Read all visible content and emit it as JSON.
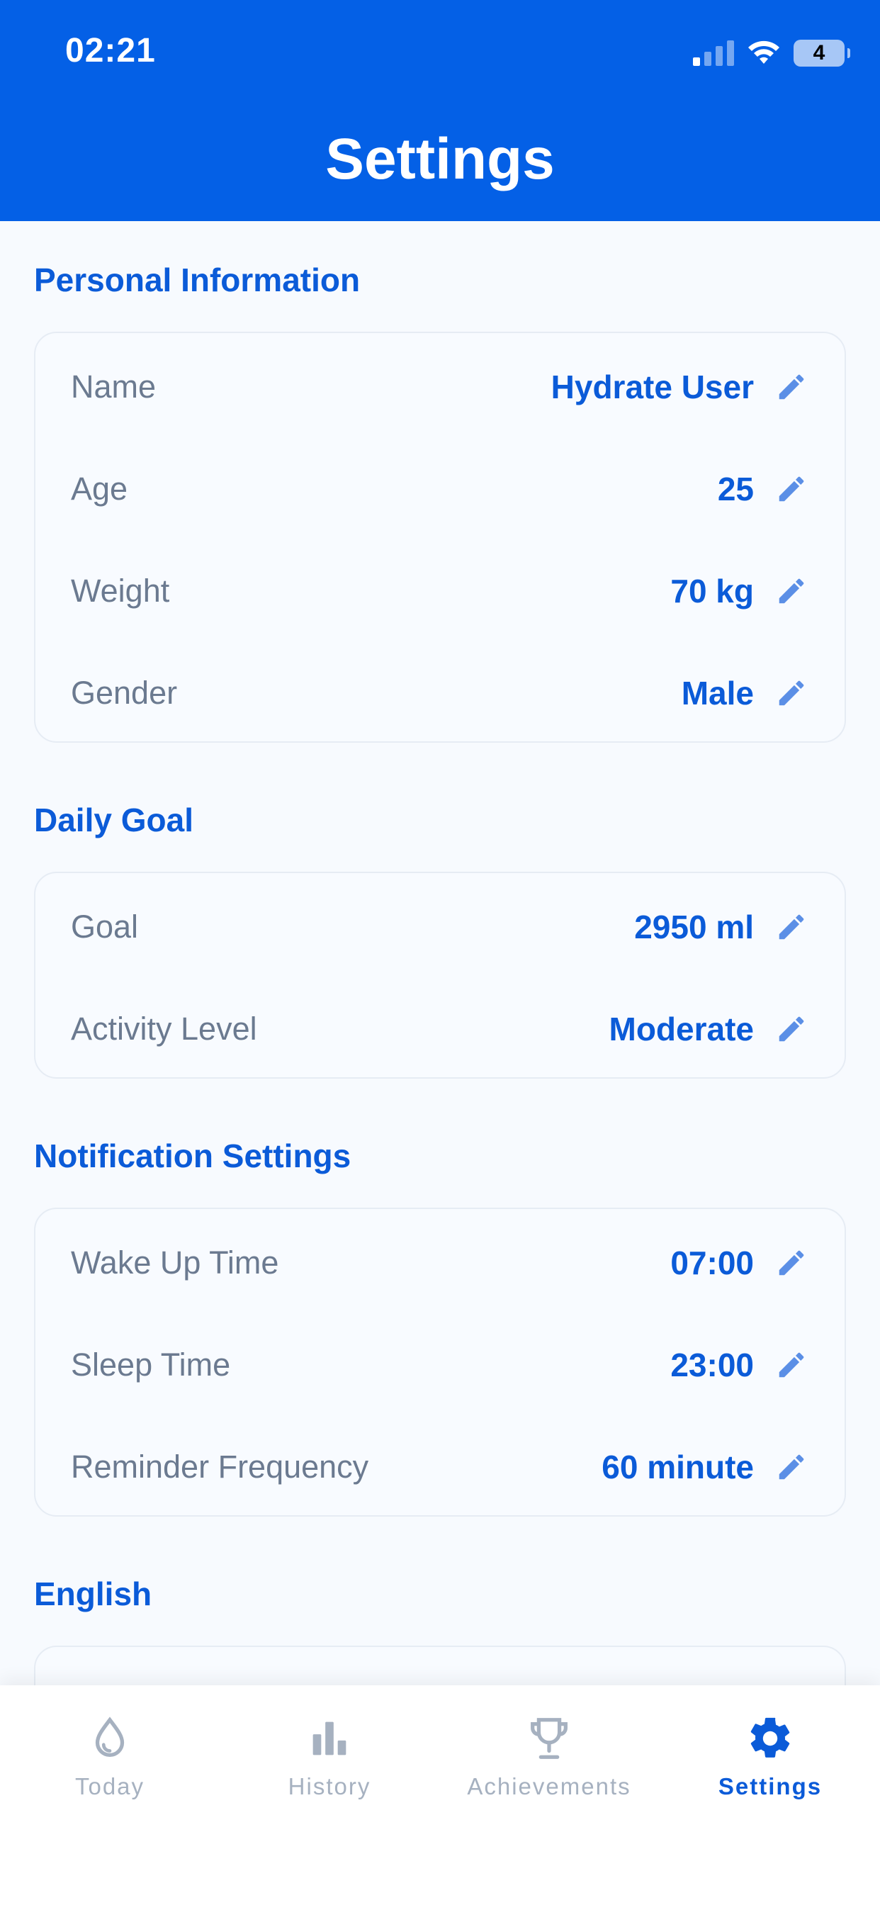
{
  "status_bar": {
    "time": "02:21",
    "battery": "4"
  },
  "header": {
    "title": "Settings"
  },
  "sections": {
    "personal": {
      "title": "Personal Information",
      "rows": [
        {
          "label": "Name",
          "value": "Hydrate User"
        },
        {
          "label": "Age",
          "value": "25"
        },
        {
          "label": "Weight",
          "value": "70 kg"
        },
        {
          "label": "Gender",
          "value": "Male"
        }
      ]
    },
    "daily_goal": {
      "title": "Daily Goal",
      "rows": [
        {
          "label": "Goal",
          "value": "2950 ml"
        },
        {
          "label": "Activity Level",
          "value": "Moderate"
        }
      ]
    },
    "notifications": {
      "title": "Notification Settings",
      "rows": [
        {
          "label": "Wake Up Time",
          "value": "07:00"
        },
        {
          "label": "Sleep Time",
          "value": "23:00"
        },
        {
          "label": "Reminder Frequency",
          "value": "60 minute"
        }
      ]
    },
    "language": {
      "title": "English"
    }
  },
  "tabs": [
    {
      "label": "Today",
      "icon": "drop-icon"
    },
    {
      "label": "History",
      "icon": "bar-chart-icon"
    },
    {
      "label": "Achievements",
      "icon": "trophy-icon"
    },
    {
      "label": "Settings",
      "icon": "gear-icon",
      "active": true
    }
  ],
  "colors": {
    "brand": "#0460E6",
    "accent_text": "#0B5BD8",
    "label": "#6B7A90",
    "inactive_tab": "#A6B1C0"
  }
}
